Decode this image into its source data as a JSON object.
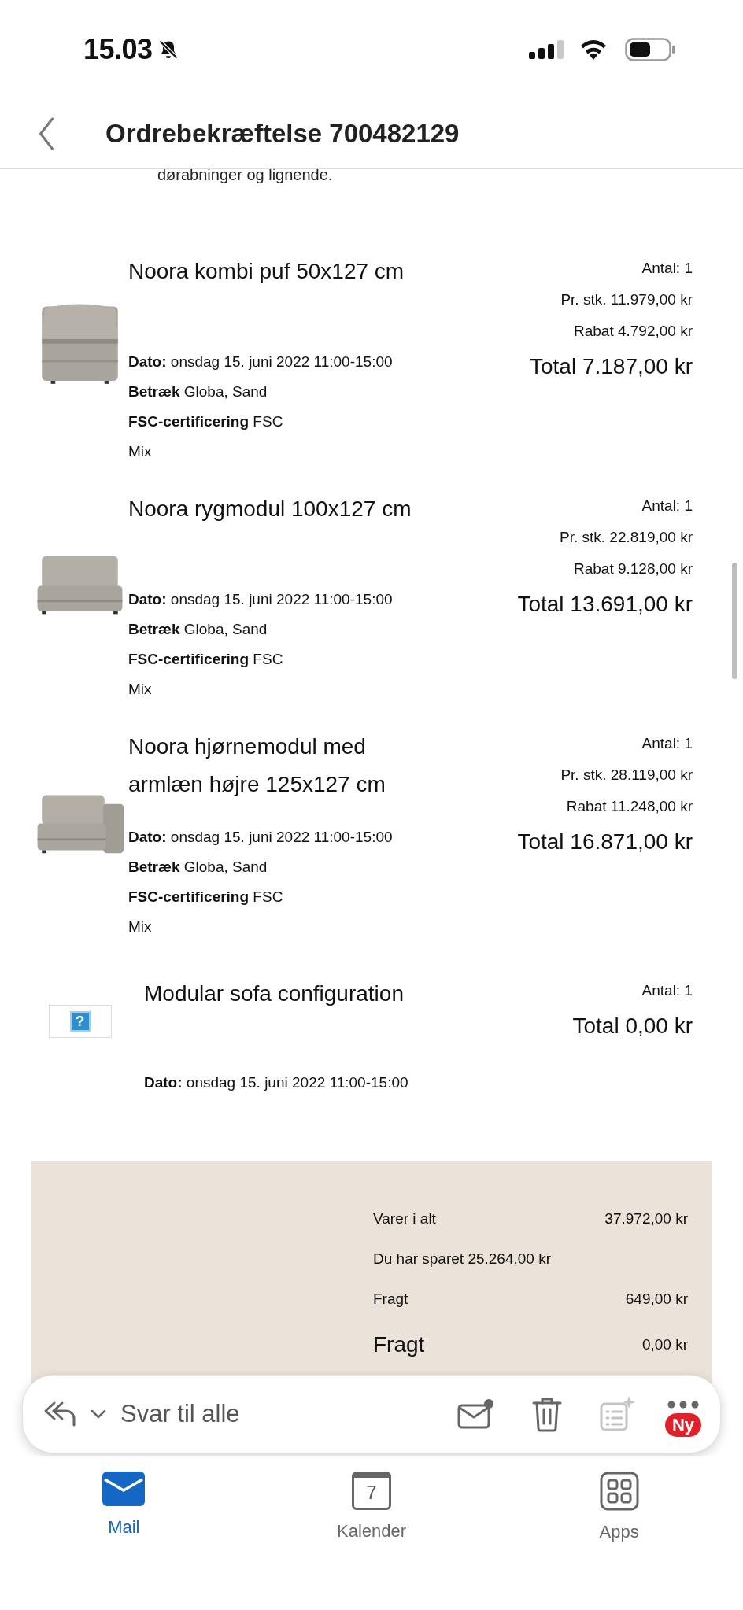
{
  "status_bar": {
    "time": "15.03",
    "muted": true
  },
  "header": {
    "title": "Ordrebekræftelse 700482129"
  },
  "intro_text": "dørabninger og lignende.",
  "items": [
    {
      "kind": "product",
      "title": "Noora kombi puf 50x127 cm",
      "quantity": "Antal: 1",
      "unit_price": "Pr. stk. 11.979,00 kr",
      "discount": "Rabat 4.792,00 kr",
      "total": "Total 7.187,00 kr",
      "details": [
        "**Dato:** onsdag 15. juni 2022 11:00-15:00",
        "**Betræk** Globa, Sand",
        "**FSC-certificering** FSC",
        "Mix"
      ]
    },
    {
      "kind": "product",
      "title": "Noora rygmodul 100x127 cm",
      "quantity": "Antal: 1",
      "unit_price": "Pr. stk. 22.819,00 kr",
      "discount": "Rabat 9.128,00 kr",
      "total": "Total 13.691,00 kr",
      "details": [
        "**Dato:** onsdag 15. juni 2022 11:00-15:00",
        "**Betræk** Globa, Sand",
        "**FSC-certificering** FSC",
        "Mix"
      ]
    },
    {
      "kind": "product",
      "title": "Noora hjørnemodul med armlæn højre 125x127 cm",
      "quantity": "Antal: 1",
      "unit_price": "Pr. stk. 28.119,00 kr",
      "discount": "Rabat 11.248,00 kr",
      "total": "Total 16.871,00 kr",
      "details": [
        "**Dato:** onsdag 15. juni 2022 11:00-15:00",
        "**Betræk** Globa, Sand",
        "**FSC-certificering** FSC",
        "Mix"
      ]
    },
    {
      "kind": "configuration",
      "image": {
        "kind": "broken",
        "icon": "?"
      },
      "title": "Modular sofa configuration",
      "quantity": "Antal: 1",
      "total": "Total 0,00 kr",
      "details": [
        "**Dato:** onsdag 15. juni 2022 11:00-15:00"
      ]
    }
  ],
  "summary": [
    {
      "label": "Varer i alt",
      "value": "37.972,00 kr",
      "emphasis": false
    },
    {
      "label": "Du har sparet 25.264,00 kr",
      "emphasis": false
    },
    {
      "label": "Fragt",
      "value": "649,00 kr",
      "emphasis": false
    },
    {
      "label": "Fragt",
      "value": "0,00 kr",
      "emphasis": true
    }
  ],
  "action_bar": {
    "reply_label": "Svar til alle",
    "unread_dot": true,
    "notes_disabled": true,
    "badge": "Ny"
  },
  "tabs": [
    {
      "kind": "mail",
      "label": "Mail",
      "selected": true
    },
    {
      "kind": "calendar",
      "label": "Kalender",
      "day": "7",
      "selected": false
    },
    {
      "kind": "apps",
      "label": "Apps",
      "selected": false
    }
  ]
}
